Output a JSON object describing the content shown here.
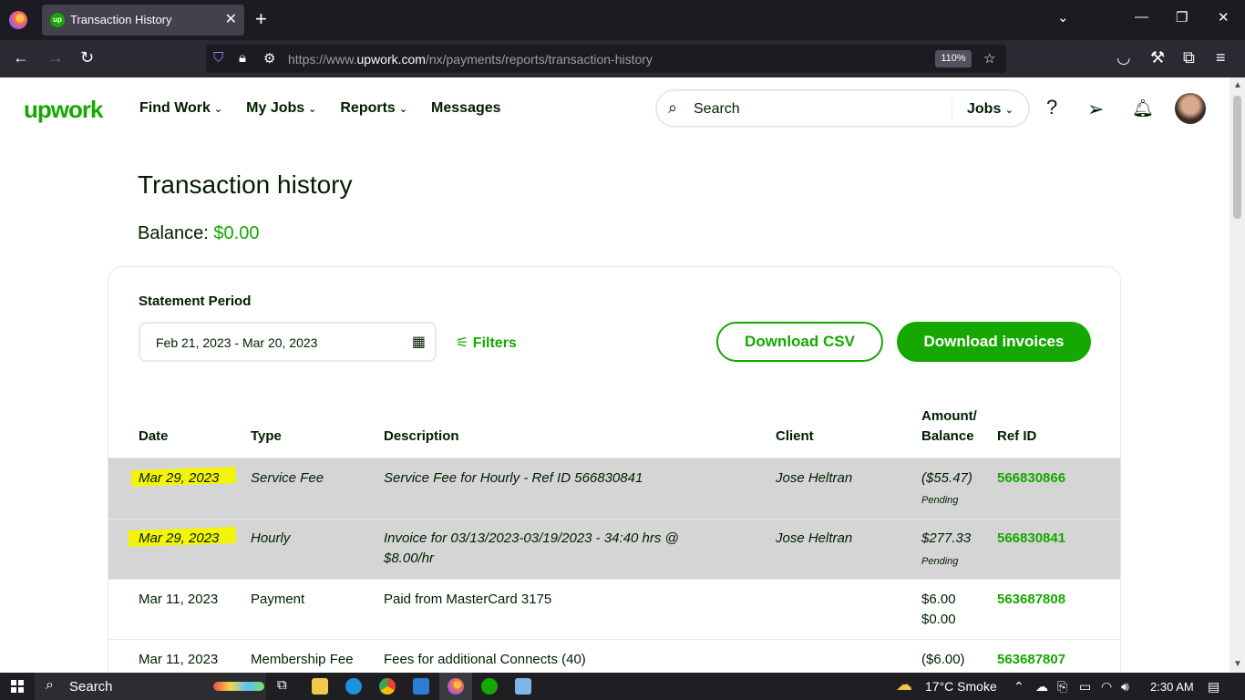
{
  "browser": {
    "tab_title": "Transaction History",
    "url_prefix": "https://www.",
    "url_domain": "upwork.com",
    "url_path": "/nx/payments/reports/transaction-history",
    "zoom": "110%"
  },
  "header": {
    "logo": "upwork",
    "nav": [
      "Find Work",
      "My Jobs",
      "Reports",
      "Messages"
    ],
    "search_placeholder": "Search",
    "search_scope": "Jobs"
  },
  "page": {
    "title": "Transaction history",
    "balance_label": "Balance:",
    "balance_value": "$0.00"
  },
  "filters": {
    "period_label": "Statement Period",
    "period_value": "Feb 21, 2023 - Mar 20, 2023",
    "filters_label": "Filters",
    "download_csv": "Download CSV",
    "download_invoices": "Download invoices"
  },
  "table": {
    "headers": {
      "date": "Date",
      "type": "Type",
      "description": "Description",
      "client": "Client",
      "amount_line1": "Amount/",
      "amount_line2": "Balance",
      "ref": "Ref ID"
    },
    "rows": [
      {
        "date": "Mar 29, 2023",
        "type": "Service Fee",
        "desc1": "Service Fee for Hourly - Ref ID 566830841",
        "desc2": "",
        "client": "Jose Heltran",
        "amount": "($55.47)",
        "balance": "Pending",
        "ref": "566830866",
        "highlighted": true
      },
      {
        "date": "Mar 29, 2023",
        "type": "Hourly",
        "desc1": "Invoice for 03/13/2023-03/19/2023 - 34:40 hrs @",
        "desc2": "$8.00/hr",
        "client": "Jose Heltran",
        "amount": "$277.33",
        "balance": "Pending",
        "ref": "566830841",
        "highlighted": true
      },
      {
        "date": "Mar 11, 2023",
        "type": "Payment",
        "desc1": "Paid from MasterCard 3175",
        "desc2": "",
        "client": "",
        "amount": "$6.00",
        "balance": "$0.00",
        "ref": "563687808",
        "highlighted": false
      },
      {
        "date": "Mar 11, 2023",
        "type": "Membership Fee",
        "desc1": "Fees for additional Connects (40)",
        "desc2": "",
        "client": "",
        "amount": "($6.00)",
        "balance": "",
        "ref": "563687807",
        "highlighted": false
      }
    ]
  },
  "taskbar": {
    "search_label": "Search",
    "weather": "17°C  Smoke",
    "time": "2:30 AM"
  },
  "colors": {
    "brand": "#14a800",
    "highlight": "#f5f500"
  }
}
